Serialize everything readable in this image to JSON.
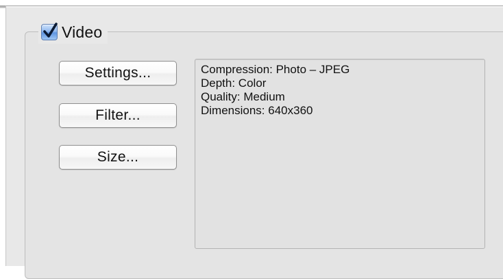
{
  "video_group": {
    "label": "Video",
    "checked": true
  },
  "buttons": {
    "settings_label": "Settings...",
    "filter_label": "Filter...",
    "size_label": "Size..."
  },
  "info": {
    "compression": "Compression: Photo – JPEG",
    "depth": "Depth: Color",
    "quality": "Quality: Medium",
    "dimensions": "Dimensions: 640x360"
  },
  "colors": {
    "panel_background": "#e8e8e8",
    "checkbox_accent": "#5f95e0"
  },
  "icons": {
    "checkbox": "checkmark-icon"
  }
}
